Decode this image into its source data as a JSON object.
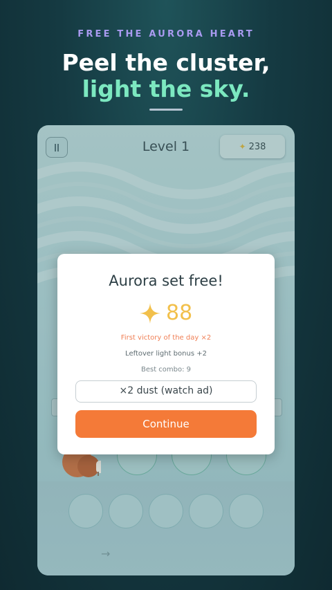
{
  "promo": {
    "tagline": "FREE THE AURORA HEART",
    "headline_line1": "Peel the cluster,",
    "headline_line2": "light the sky."
  },
  "game": {
    "level_label": "Level 1",
    "dust_count": "238",
    "pause_icon": "pause-icon",
    "dust_icon": "sparkle-icon",
    "arrow_icon": "arrow-right-icon",
    "bottom_arrow": "→"
  },
  "modal": {
    "title": "Aurora set free!",
    "reward_amount": "88",
    "bonus_first_victory": "First victory of the day ×2",
    "bonus_leftover": "Leftover light bonus +2",
    "best_combo": "Best combo: 9",
    "ad_button_label": "×2 dust (watch ad)",
    "continue_label": "Continue"
  },
  "colors": {
    "background": "#153a42",
    "tagline": "#a99af0",
    "headline_accent": "#7ce8c0",
    "reward_gold": "#f2c04b",
    "bonus_orange": "#f07f55",
    "continue_button": "#f47a38"
  }
}
